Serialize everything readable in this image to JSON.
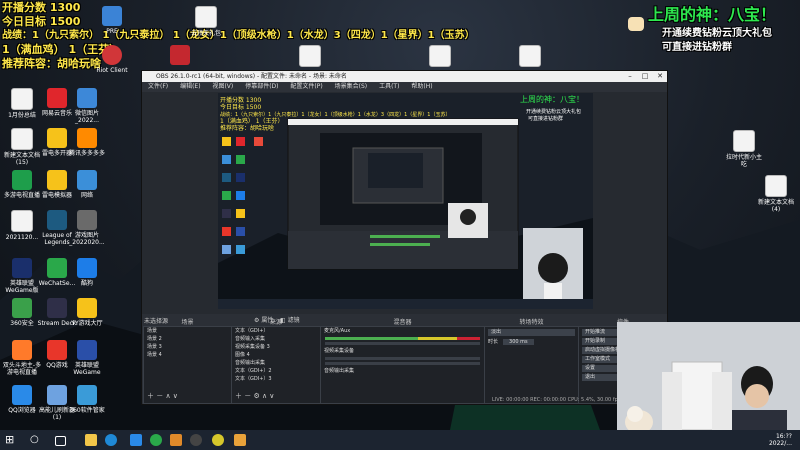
{
  "overlay": {
    "line1": "开播分数 1300",
    "line2": "今日目标 1500",
    "line3": "战绩：1（九只索尔） 1（九只泰拉） 1（龙女）1（顶级水枪）1（水龙）3（四龙）1（星界）1（玉苏）",
    "line4": "1（满血鸡） 1（王芬）",
    "line5": "推荐阵容：胡哈玩啥",
    "top_right_title": "上周的神：八宝！",
    "top_right_line1": "开通续费钻粉云顶大礼包",
    "top_right_line2": "可直接进钻粉群"
  },
  "desktop_icons": [
    {
      "label": "1月份总结",
      "color": "#f3f3f3"
    },
    {
      "label": "网易云音乐",
      "color": "#e0262c"
    },
    {
      "label": "微信图片_2022...",
      "color": "#3d88d8"
    },
    {
      "label": "新建文本文档(15)",
      "color": "#f3f3f3"
    },
    {
      "label": "雷电多开器",
      "color": "#f6c21a"
    },
    {
      "label": "腾讯多多多多",
      "color": "#ff8a00"
    },
    {
      "label": "多游电视直播",
      "color": "#1e9e4b"
    },
    {
      "label": "雷电模拟器",
      "color": "#f6c21a"
    },
    {
      "label": "网络",
      "color": "#3b8fd9"
    },
    {
      "label": "2021120...",
      "color": "#f3f3f3"
    },
    {
      "label": "League of Legends",
      "color": "#1d5a80"
    },
    {
      "label": "游戏图片_2022020...",
      "color": "#6a6a6a"
    },
    {
      "label": "英雄联盟WeGame版",
      "color": "#1a2f6b"
    },
    {
      "label": "WeChatSe...",
      "color": "#2aa84a"
    },
    {
      "label": "酷狗",
      "color": "#1d7de8"
    },
    {
      "label": "360安全",
      "color": "#3aa04a"
    },
    {
      "label": "Stream Deck",
      "color": "#2f2f48"
    },
    {
      "label": "YY游戏大厅",
      "color": "#f6c21a"
    },
    {
      "label": "双头斗地主-多游电视直播",
      "color": "#ff7a2a"
    },
    {
      "label": "QQ游戏",
      "color": "#e8362a"
    },
    {
      "label": "英雄联盟WeGame",
      "color": "#2a4fa8"
    },
    {
      "label": "QQ浏览器",
      "color": "#2a8ae8"
    },
    {
      "label": "高能儿刷新器(1)",
      "color": "#6ea2e0"
    },
    {
      "label": "360软件管家",
      "color": "#3a9bd8"
    },
    {
      "label": "360画报",
      "color": "#e84a3a"
    }
  ],
  "top_icons": [
    {
      "label": "PRE"
    },
    {
      "label": "云顶天礼包"
    },
    {
      "label": "Riot Client"
    }
  ],
  "right_icons": [
    {
      "label": "拉时代新小主 吃"
    },
    {
      "label": "新建文本文档(4)"
    }
  ],
  "obs": {
    "title": "OBS 26.1.0-rc1 (64-bit, windows) - 配置文件: 未命名 - 场景: 未命名",
    "menu": [
      "文件(F)",
      "编辑(E)",
      "视图(V)",
      "停靠部件(D)",
      "配置文件(P)",
      "场景集合(S)",
      "工具(T)",
      "帮助(H)"
    ],
    "no_source": "未选择源",
    "props_btn": "属性",
    "filter_btn": "滤镜",
    "scenes_header": "场景",
    "scenes": [
      "场景",
      "场景 2",
      "场景 3",
      "场景 4"
    ],
    "sources_header": "来源",
    "sources": [
      "文本（GDI+）",
      "音频输入采集",
      "视频采集设备 3",
      "图像 4",
      "音频输出采集",
      "文本（GDI+）2",
      "文本（GDI+）3"
    ],
    "mixer_header": "混音器",
    "mixer": [
      "麦克风/Aux",
      "视频采集设备",
      "音频输出采集"
    ],
    "transitions_header": "转场特效",
    "transition_value": "淡出",
    "duration_label": "时长",
    "duration_value": "300 ms",
    "controls_header": "控件",
    "controls": [
      "开始推流",
      "开始录制",
      "启动虚拟摄像机",
      "工作室模式",
      "设置",
      "退出"
    ],
    "status": "LIVE: 00:00:00  REC: 00:00:00  CPU: 5.4%, 30.00 fps"
  },
  "colors": {
    "overlay_yellow": "#ffe84a",
    "overlay_green": "#2ee84f",
    "obs_bg": "#262a30"
  },
  "taskbar": {
    "time": "16:??",
    "date": "2022/..."
  }
}
